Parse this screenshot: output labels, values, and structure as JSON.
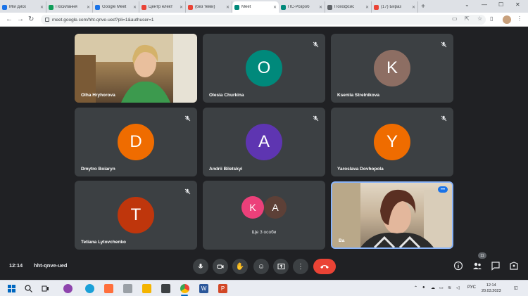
{
  "browser": {
    "tabs": [
      {
        "label": "Мій диск",
        "color": "#1a73e8"
      },
      {
        "label": "Посилання",
        "color": "#0f9d58"
      },
      {
        "label": "Google Meet",
        "color": "#1a73e8"
      },
      {
        "label": "Центр елект",
        "color": "#ea4335"
      },
      {
        "label": "(без теми)",
        "color": "#ea4335"
      },
      {
        "label": "Meet",
        "color": "#00897b"
      },
      {
        "label": "ПС-Розроб",
        "color": "#00897b"
      },
      {
        "label": "Похофсис",
        "color": "#5f6368"
      },
      {
        "label": "(17) Бираз",
        "color": "#ea4335"
      }
    ],
    "active_tab_index": 5,
    "url": "meet.google.com/hht-qnve-ued?pli=1&authuser=1"
  },
  "meet": {
    "participants": [
      {
        "name": "Olha Hryhorova",
        "letter": "",
        "color": "",
        "video": "photo-olha",
        "muted": false
      },
      {
        "name": "Olesia Churkina",
        "letter": "O",
        "color": "#00897b",
        "video": "",
        "muted": true
      },
      {
        "name": "Kseniia Strelnikova",
        "letter": "K",
        "color": "#8d6e63",
        "video": "",
        "muted": true
      },
      {
        "name": "Dmytro Boiaryn",
        "letter": "D",
        "color": "#ef6c00",
        "video": "",
        "muted": true
      },
      {
        "name": "Andrii Biletskyi",
        "letter": "A",
        "color": "#5e35b1",
        "video": "",
        "muted": true
      },
      {
        "name": "Yaroslava Dovhopola",
        "letter": "Y",
        "color": "#ef6c00",
        "video": "",
        "muted": true
      },
      {
        "name": "Tetiana Lytovchenko",
        "letter": "T",
        "color": "#bf360c",
        "video": "",
        "muted": true
      }
    ],
    "others_tile": {
      "avatars": [
        {
          "letter": "K",
          "color": "#ec407a"
        },
        {
          "letter": "A",
          "color": "#5d4037"
        }
      ],
      "label": "Ще 3 особи"
    },
    "self_tile_name": "Ba",
    "time": "12:14",
    "meeting_code": "hht-qnve-ued",
    "participant_count": "11"
  },
  "taskbar": {
    "lang": "РУС",
    "time": "12:14",
    "date": "20.03.2023"
  }
}
